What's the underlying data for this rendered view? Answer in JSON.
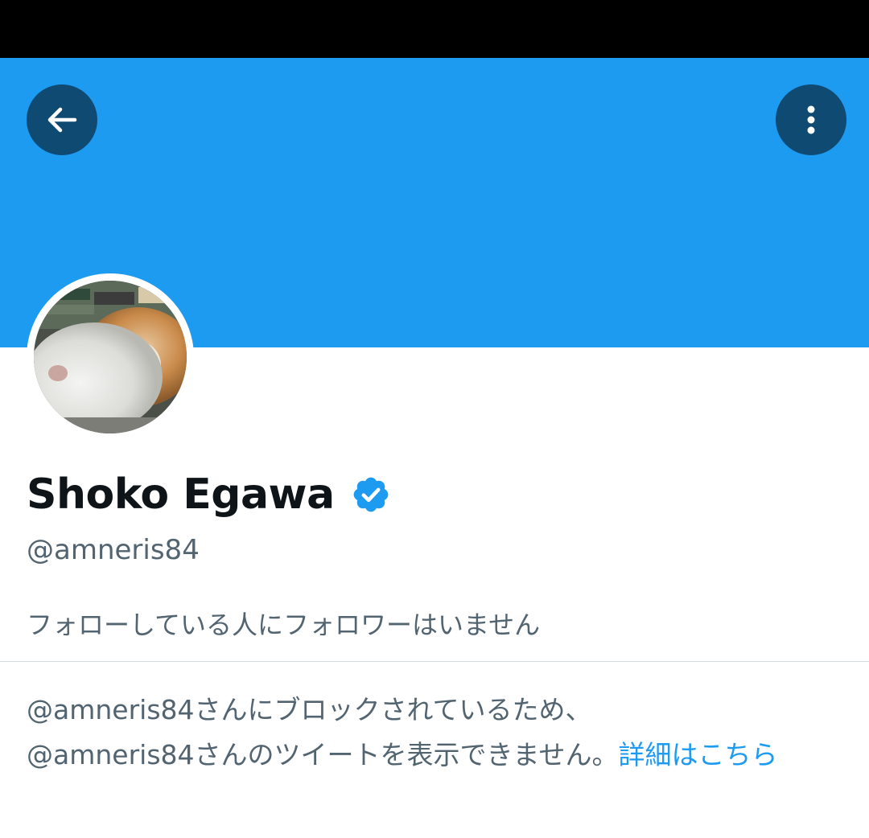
{
  "colors": {
    "banner": "#1d9bf0",
    "button_bg": "#0f4a73",
    "link": "#1d9bf0",
    "name": "#0f1419",
    "secondary_text": "#536471"
  },
  "header": {
    "back_icon": "arrow-left-icon",
    "more_icon": "vertical-ellipsis-icon"
  },
  "profile": {
    "display_name": "Shoko Egawa",
    "verified_icon": "verified-badge-icon",
    "handle": "@amneris84",
    "followers_note": "フォローしている人にフォロワーはいません"
  },
  "blocked": {
    "line1": "@amneris84さんにブロックされているため、",
    "line2": "@amneris84さんのツイートを表示できません。",
    "link_text": "詳細はこちら"
  }
}
